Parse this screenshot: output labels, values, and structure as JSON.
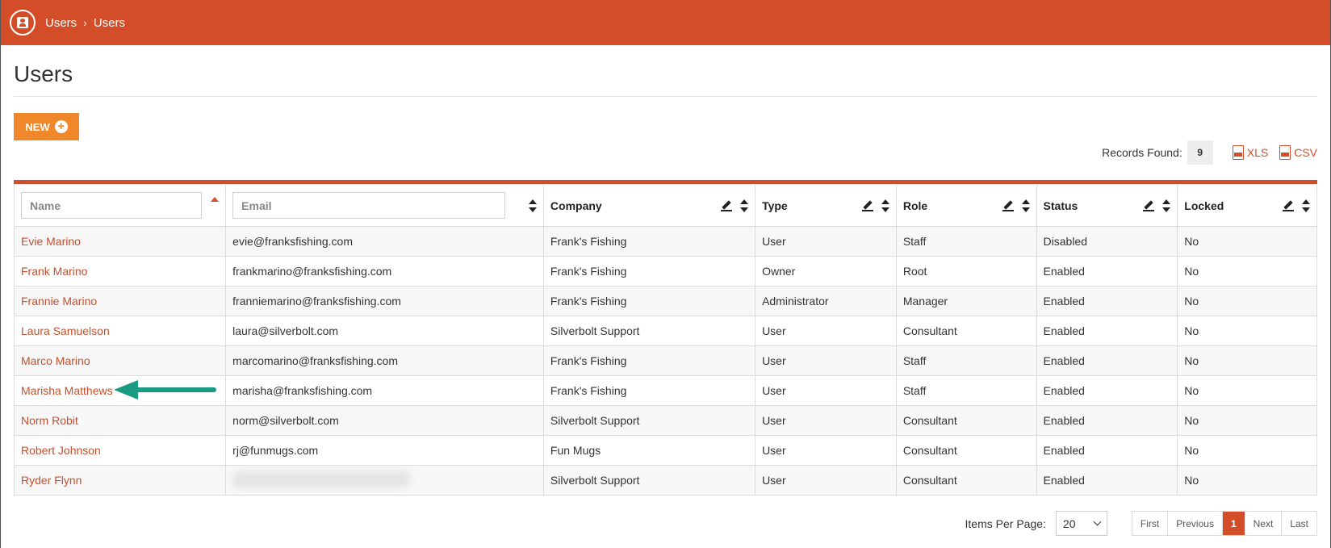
{
  "breadcrumb": {
    "root": "Users",
    "current": "Users"
  },
  "page": {
    "title": "Users"
  },
  "toolbar": {
    "new_label": "NEW"
  },
  "records": {
    "label": "Records Found:",
    "count": "9"
  },
  "exports": {
    "xls": "XLS",
    "csv": "CSV"
  },
  "columns": {
    "name": {
      "placeholder": "Name"
    },
    "email": {
      "placeholder": "Email"
    },
    "company": "Company",
    "type": "Type",
    "role": "Role",
    "status": "Status",
    "locked": "Locked"
  },
  "rows": [
    {
      "name": "Evie Marino",
      "email": "evie@franksfishing.com",
      "company": "Frank's Fishing",
      "type": "User",
      "role": "Staff",
      "status": "Disabled",
      "locked": "No"
    },
    {
      "name": "Frank Marino",
      "email": "frankmarino@franksfishing.com",
      "company": "Frank's Fishing",
      "type": "Owner",
      "role": "Root",
      "status": "Enabled",
      "locked": "No"
    },
    {
      "name": "Frannie Marino",
      "email": "franniemarino@franksfishing.com",
      "company": "Frank's Fishing",
      "type": "Administrator",
      "role": "Manager",
      "status": "Enabled",
      "locked": "No"
    },
    {
      "name": "Laura Samuelson",
      "email": "laura@silverbolt.com",
      "company": "Silverbolt Support",
      "type": "User",
      "role": "Consultant",
      "status": "Enabled",
      "locked": "No"
    },
    {
      "name": "Marco Marino",
      "email": "marcomarino@franksfishing.com",
      "company": "Frank's Fishing",
      "type": "User",
      "role": "Staff",
      "status": "Enabled",
      "locked": "No"
    },
    {
      "name": "Marisha Matthews",
      "email": "marisha@franksfishing.com",
      "company": "Frank's Fishing",
      "type": "User",
      "role": "Staff",
      "status": "Enabled",
      "locked": "No"
    },
    {
      "name": "Norm Robit",
      "email": "norm@silverbolt.com",
      "company": "Silverbolt Support",
      "type": "User",
      "role": "Consultant",
      "status": "Enabled",
      "locked": "No"
    },
    {
      "name": "Robert Johnson",
      "email": "rj@funmugs.com",
      "company": "Fun Mugs",
      "type": "User",
      "role": "Consultant",
      "status": "Enabled",
      "locked": "No"
    },
    {
      "name": "Ryder Flynn",
      "email": "",
      "company": "Silverbolt Support",
      "type": "User",
      "role": "Consultant",
      "status": "Enabled",
      "locked": "No"
    }
  ],
  "pagination": {
    "items_per_page_label": "Items Per Page:",
    "items_per_page": "20",
    "first": "First",
    "previous": "Previous",
    "current": "1",
    "next": "Next",
    "last": "Last"
  },
  "colors": {
    "brand": "#d44d29",
    "accent": "#f0882b",
    "annotation_arrow": "#1a9a83"
  },
  "icons": {
    "app": "user-badge-icon",
    "new": "plus-circle-icon",
    "xls": "xls-file-icon",
    "csv": "csv-file-icon"
  }
}
